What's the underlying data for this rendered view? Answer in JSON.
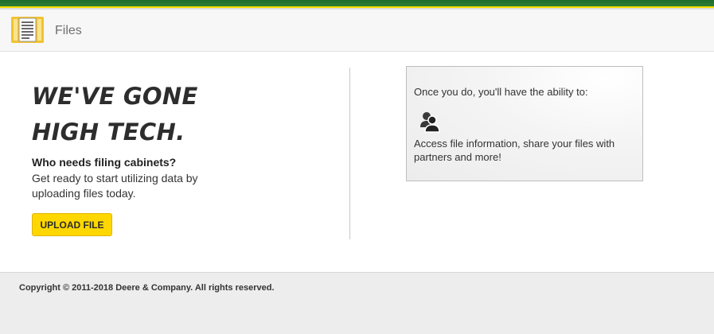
{
  "header": {
    "title": "Files",
    "app_icon": "file-cabinet-icon"
  },
  "hero": {
    "headline_line1": "WE'VE GONE",
    "headline_line2": "HIGH TECH.",
    "subhead": "Who needs filing cabinets?",
    "body": "Get ready to start utilizing data by uploading files today.",
    "upload_button_label": "UPLOAD FILE"
  },
  "info_box": {
    "intro": "Once you do, you'll have the ability to:",
    "icon": "people-icon",
    "detail": "Access file information, share your files with partners and more!"
  },
  "footer": {
    "copyright": "Copyright © 2011-2018 Deere & Company. All rights reserved."
  },
  "colors": {
    "brand_green": "#2e7d32",
    "brand_yellow": "#ffd700",
    "icon_gold": "#e8b92d"
  }
}
